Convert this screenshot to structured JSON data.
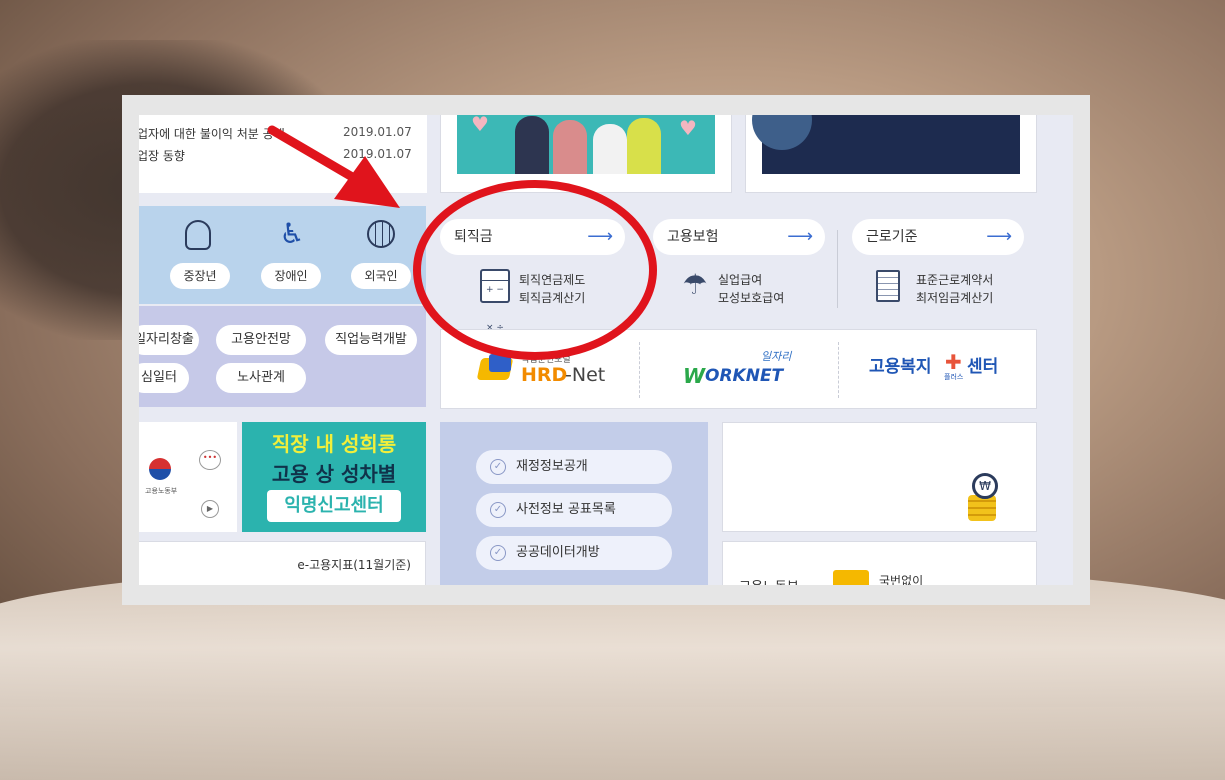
{
  "news": [
    {
      "title": "업자에 대한 불이익 처분 공개",
      "date": "2019.01.07"
    },
    {
      "title": "업장 동향",
      "date": "2019.01.07"
    }
  ],
  "category_icons": [
    {
      "label": "중장년",
      "icon": "senior-man-icon"
    },
    {
      "label": "장애인",
      "icon": "wheelchair-icon"
    },
    {
      "label": "외국인",
      "icon": "globe-icon"
    }
  ],
  "service_pills": [
    "일자리창출",
    "고용안전망",
    "직업능력개발",
    "심일터",
    "노사관계"
  ],
  "tabs": [
    {
      "title": "퇴직금",
      "links": [
        "퇴직연금제도",
        "퇴직금계산기"
      ],
      "icon": "calculator-icon"
    },
    {
      "title": "고용보험",
      "links": [
        "실업급여",
        "모성보호급여"
      ],
      "icon": "umbrella-won-icon"
    },
    {
      "title": "근로기준",
      "links": [
        "표준근로계약서",
        "최저임금계산기"
      ],
      "icon": "document-pencil-icon"
    }
  ],
  "partners": {
    "hrd": {
      "top": "직업훈련포털",
      "name_a": "HRD",
      "name_b": "-Net"
    },
    "worknet": {
      "top": "일자리",
      "name_a": "W",
      "name_b": "ORKNET"
    },
    "welfare": {
      "name_a": "고용복지",
      "name_b": "센터",
      "sub": "플러스"
    }
  },
  "harassment_banner": {
    "line1": "직장 내 성희롱",
    "line2": "고용 상 성차별",
    "line3": "익명신고센터"
  },
  "ministry_logo_text": "고용노동부",
  "public_links": [
    "재정정보공개",
    "사전정보 공표목록",
    "공공데이터개방"
  ],
  "indicator_label": "e-고용지표(11월기준)",
  "bottom_card": {
    "left": "고용노동부",
    "right": "국번없이"
  },
  "accent": {
    "annotation_red": "#e0141c",
    "blue": "#3b6dd1",
    "teal": "#3cb8b6"
  }
}
